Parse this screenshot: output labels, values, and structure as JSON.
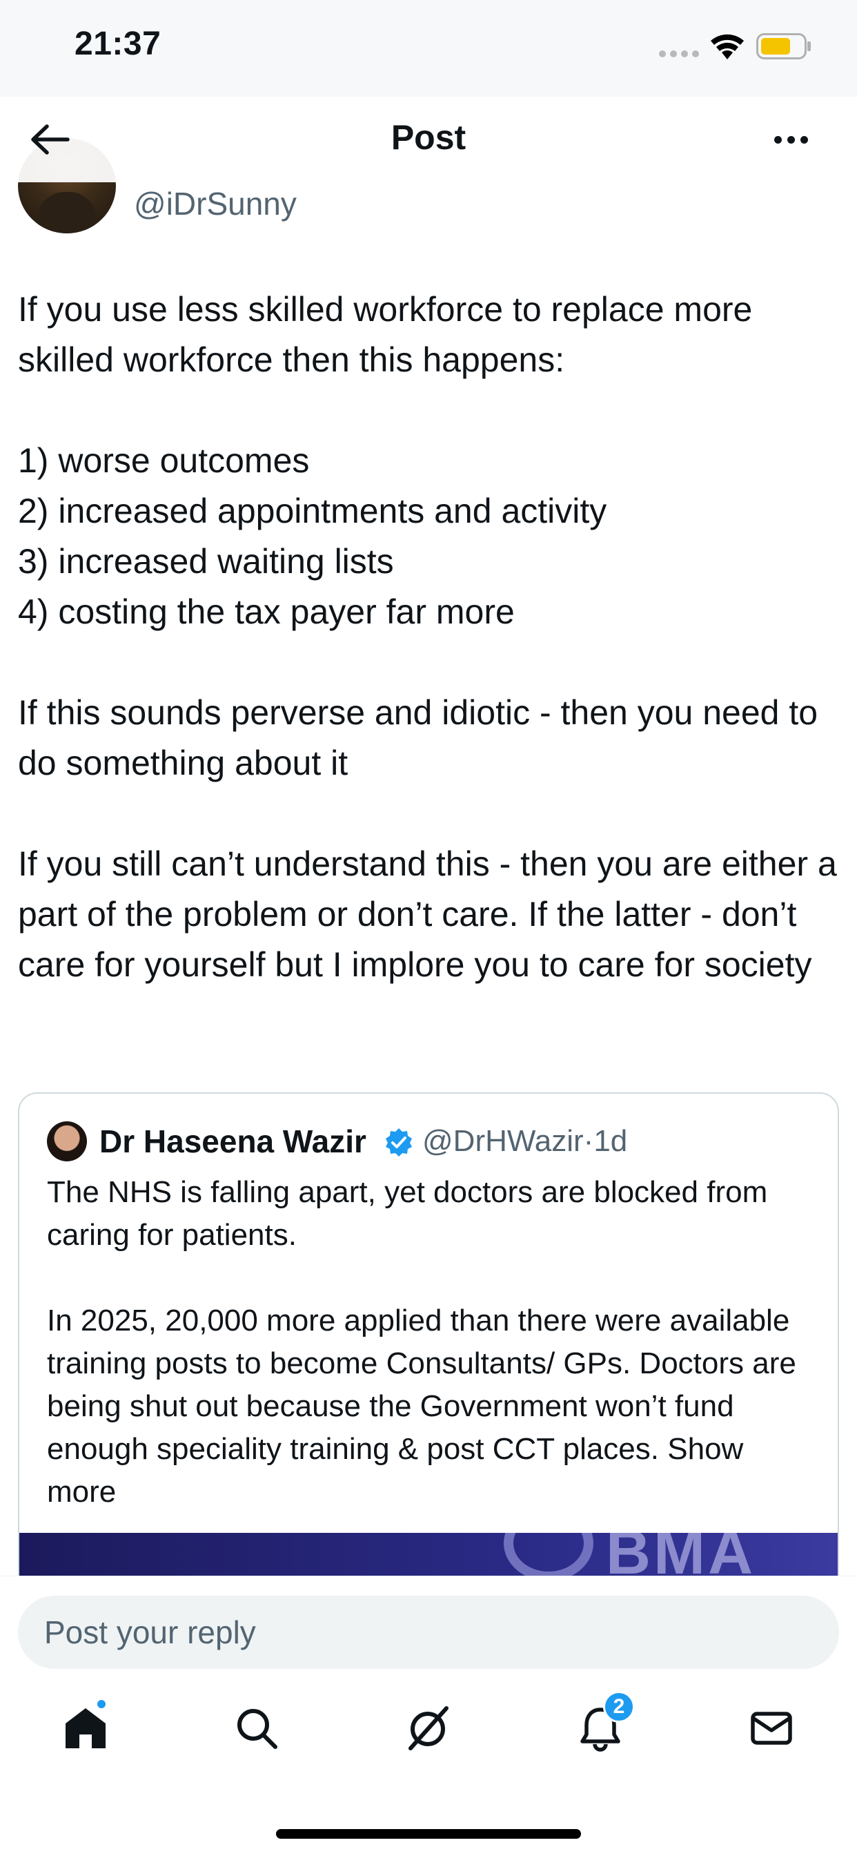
{
  "status_bar": {
    "time": "21:37",
    "icons": [
      "signal-dots-icon",
      "wifi-icon",
      "battery-icon"
    ],
    "battery_color": "#f5c400"
  },
  "header": {
    "title": "Post",
    "back_icon": "arrow-left-icon",
    "more_icon": "more-horizontal-icon"
  },
  "author": {
    "handle": "@iDrSunny"
  },
  "tweet": {
    "lines": [
      "If you use less skilled workforce to replace more skilled workforce then this happens:",
      "",
      "1) worse outcomes",
      "2) increased appointments and activity",
      "3) increased waiting lists",
      "4) costing the tax payer far more",
      "",
      "If this sounds perverse and idiotic - then you need to do something about it",
      "",
      "If you still can’t understand this - then you are either a part of the problem or don’t care. If the latter - don’t care for yourself but I implore you to care for society"
    ]
  },
  "quote": {
    "name": "Dr Haseena Wazir",
    "handle": "@DrHWazir",
    "time": "1d",
    "separator": "·",
    "text_p1": "The NHS is falling apart, yet doctors are blocked from caring for patients.",
    "text_p2": "In 2025, 20,000 more applied than there were available training posts to become Consultants/ GPs. Doctors are being shut out because the Government won’t fund enough speciality training & post CCT places.",
    "show_more": "Show more",
    "media_text": "BMA",
    "verified_color": "#1d9bf0"
  },
  "reply": {
    "placeholder": "Post your reply"
  },
  "tabbar": {
    "items": [
      "home-icon",
      "search-icon",
      "grok-icon",
      "notifications-icon",
      "messages-icon"
    ],
    "notification_count": "2",
    "accent": "#1d9bf0"
  }
}
